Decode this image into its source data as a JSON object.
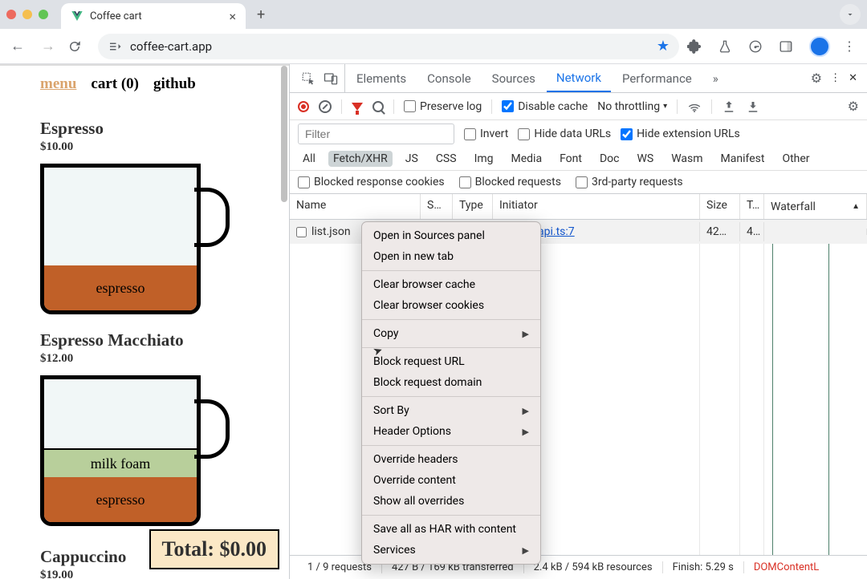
{
  "browser": {
    "tab_title": "Coffee cart",
    "url": "coffee-cart.app"
  },
  "page": {
    "nav": {
      "menu": "menu",
      "cart": "cart (0)",
      "github": "github"
    },
    "products": [
      {
        "name": "Espresso",
        "price": "$10.00",
        "layers": [
          {
            "label": "espresso"
          }
        ]
      },
      {
        "name": "Espresso Macchiato",
        "price": "$12.00",
        "layers": [
          {
            "label": "milk foam"
          },
          {
            "label": "espresso"
          }
        ]
      },
      {
        "name": "Cappuccino",
        "price": "$19.00"
      }
    ],
    "total": "Total: $0.00"
  },
  "devtools": {
    "tabs": {
      "elements": "Elements",
      "console": "Console",
      "sources": "Sources",
      "network": "Network",
      "performance": "Performance"
    },
    "toolbar": {
      "preserve_log": "Preserve log",
      "disable_cache": "Disable cache",
      "throttling": "No throttling"
    },
    "filter": {
      "placeholder": "Filter",
      "invert": "Invert",
      "hide_data_urls": "Hide data URLs",
      "hide_ext_urls": "Hide extension URLs"
    },
    "types": {
      "all": "All",
      "fetch": "Fetch/XHR",
      "js": "JS",
      "css": "CSS",
      "img": "Img",
      "media": "Media",
      "font": "Font",
      "doc": "Doc",
      "ws": "WS",
      "wasm": "Wasm",
      "manifest": "Manifest",
      "other": "Other"
    },
    "checks": {
      "brc": "Blocked response cookies",
      "br": "Blocked requests",
      "tp": "3rd-party requests"
    },
    "columns": {
      "name": "Name",
      "status": "S…",
      "type": "Type",
      "initiator": "Initiator",
      "size": "Size",
      "time": "T…",
      "waterfall": "Waterfall"
    },
    "rows": [
      {
        "name": "list.json",
        "initiator": "api.ts:7",
        "size": "42…",
        "time": "4…"
      }
    ],
    "status": {
      "reqs": "1 / 9 requests",
      "xfer": "427 B / 169 kB transferred",
      "res": "2.4 kB / 594 kB resources",
      "finish": "Finish: 5.29 s",
      "dom": "DOMContentL"
    }
  },
  "context_menu": {
    "open_sources": "Open in Sources panel",
    "open_tab": "Open in new tab",
    "clear_cache": "Clear browser cache",
    "clear_cookies": "Clear browser cookies",
    "copy": "Copy",
    "block_url": "Block request URL",
    "block_domain": "Block request domain",
    "sort_by": "Sort By",
    "header_options": "Header Options",
    "override_headers": "Override headers",
    "override_content": "Override content",
    "show_overrides": "Show all overrides",
    "save_har": "Save all as HAR with content",
    "services": "Services"
  }
}
